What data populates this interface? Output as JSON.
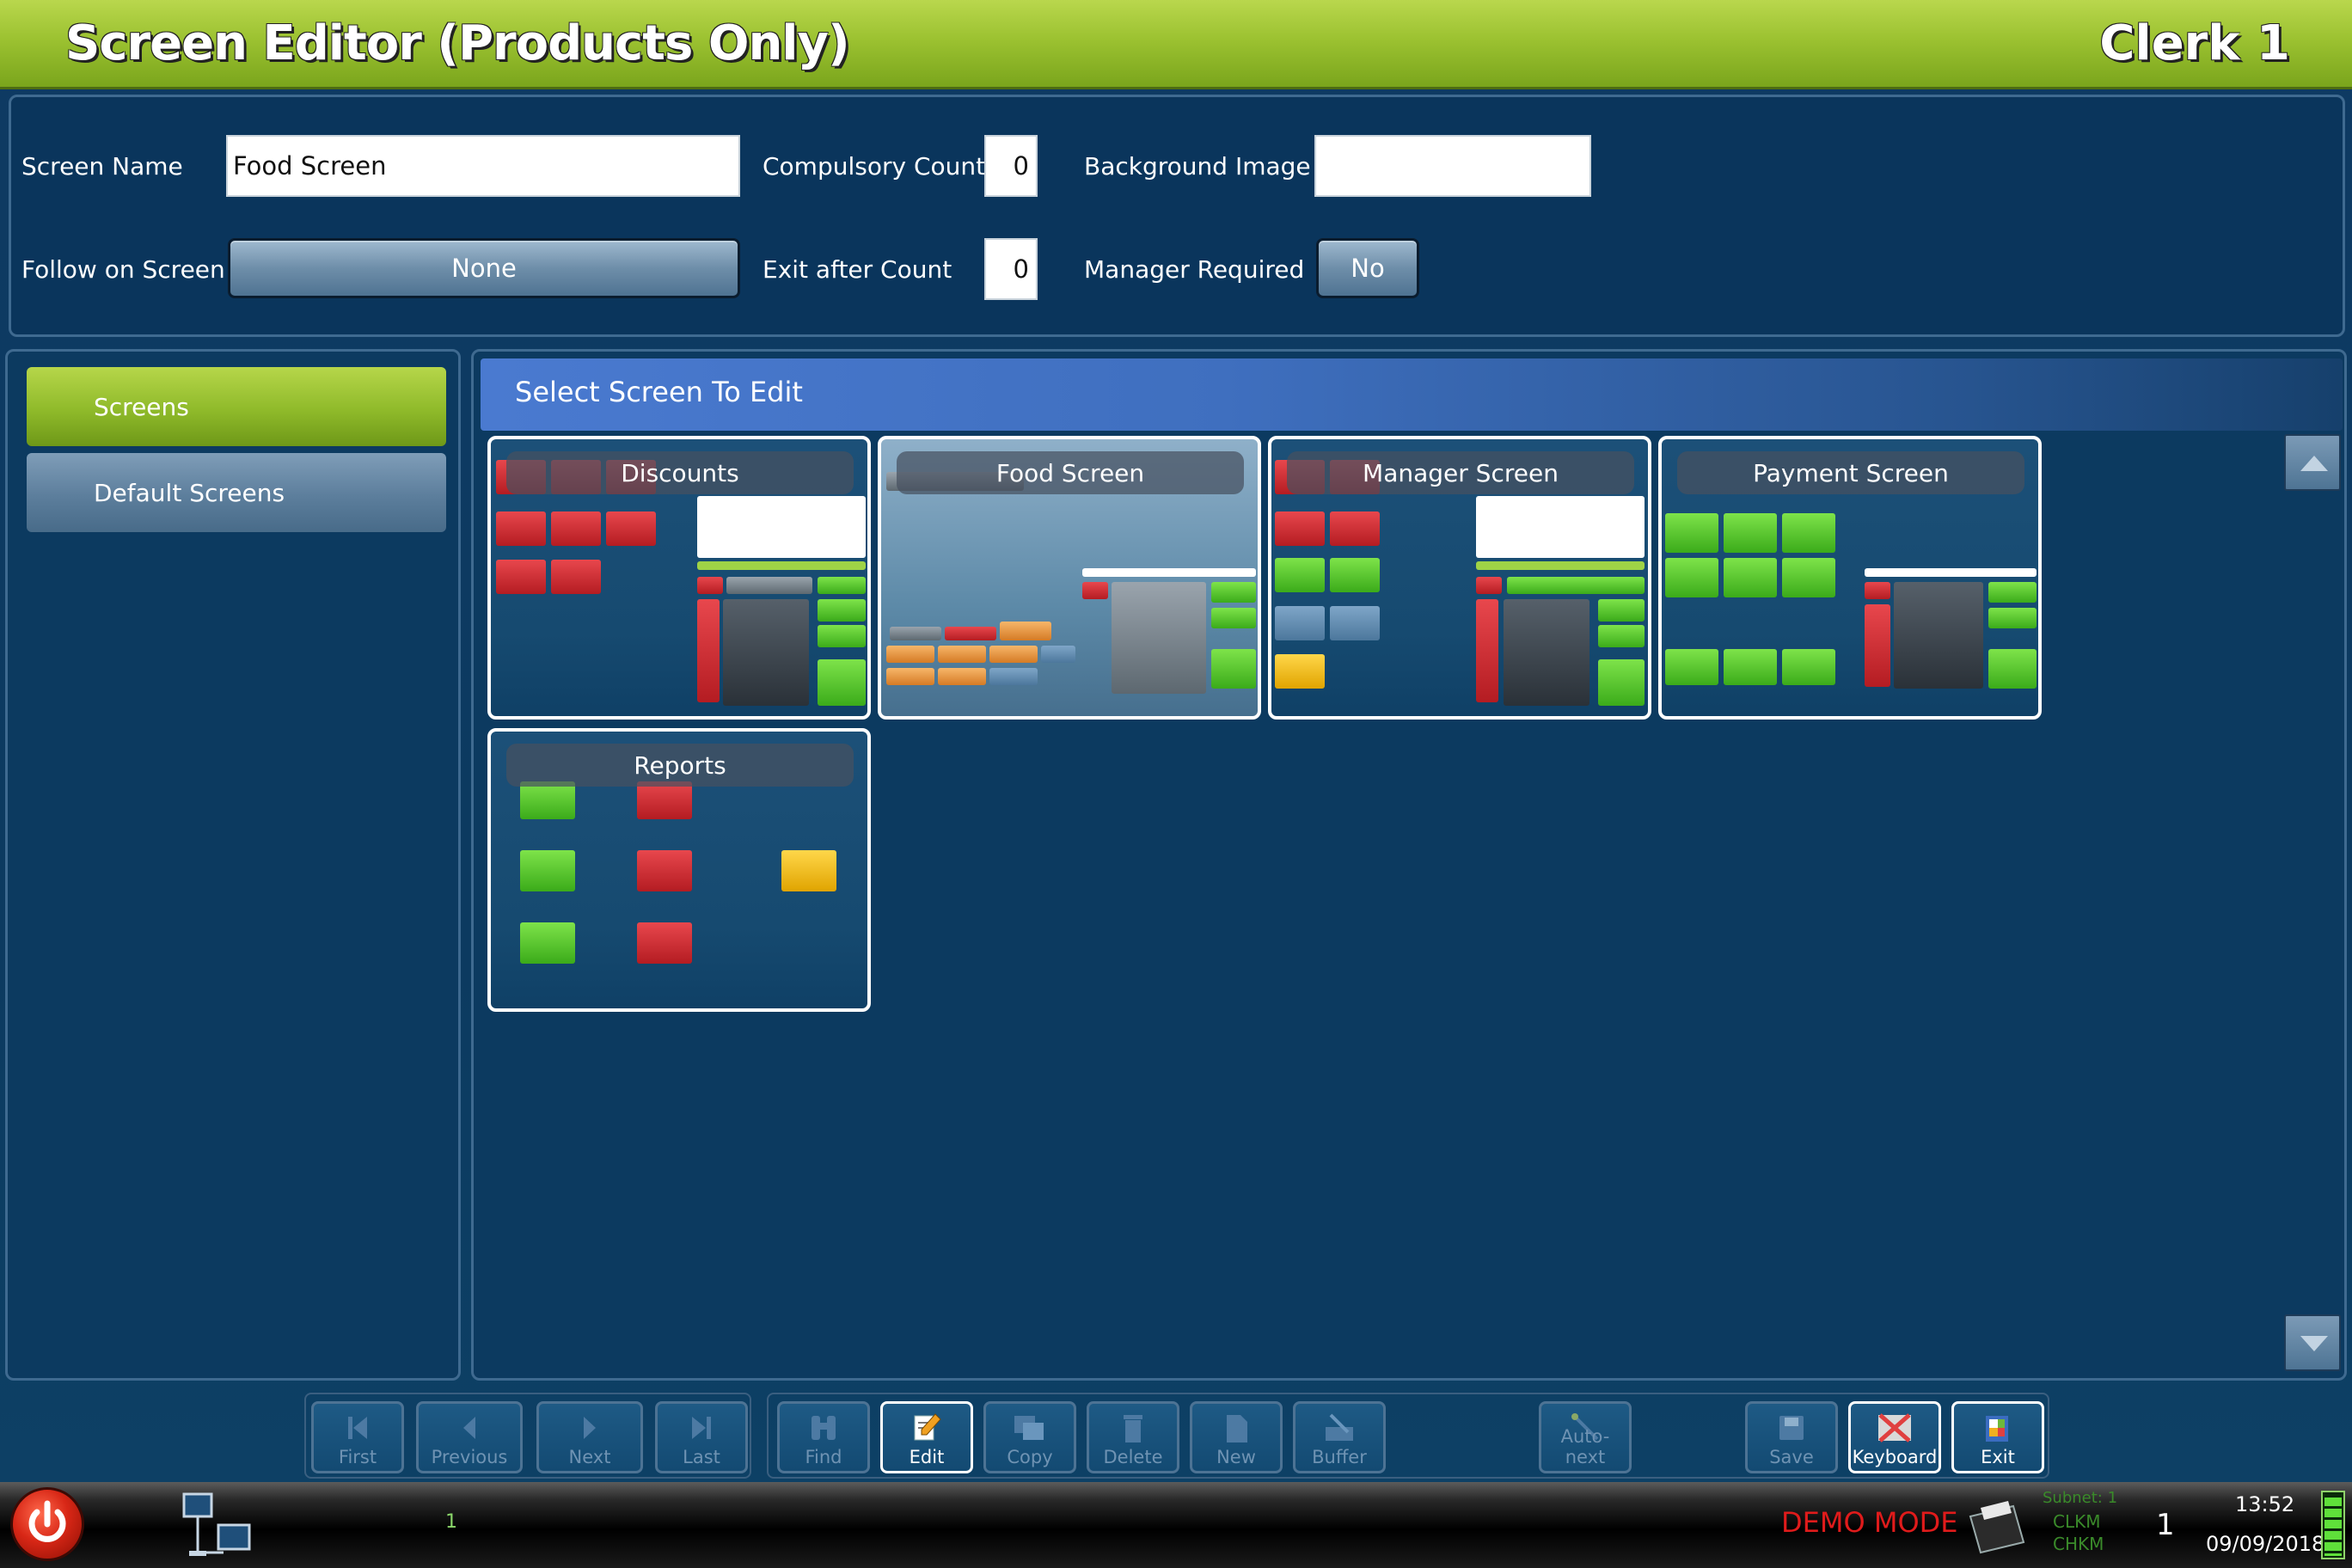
{
  "titlebar": {
    "title": "Screen Editor (Products Only)",
    "clerk": "Clerk 1"
  },
  "properties": {
    "screen_name_label": "Screen Name",
    "screen_name_value": "Food Screen",
    "compulsory_count_label": "Compulsory Count",
    "compulsory_count_value": "0",
    "background_image_label": "Background Image",
    "background_image_value": "",
    "follow_on_label": "Follow on Screen",
    "follow_on_value": "None",
    "exit_after_label": "Exit after Count",
    "exit_after_value": "0",
    "manager_required_label": "Manager Required",
    "manager_required_value": "No"
  },
  "sidebar": {
    "items": [
      {
        "label": "Screens",
        "active": true
      },
      {
        "label": "Default Screens",
        "active": false
      }
    ]
  },
  "main": {
    "header": "Select Screen To Edit",
    "tiles": [
      {
        "name": "Discounts"
      },
      {
        "name": "Food Screen"
      },
      {
        "name": "Manager Screen"
      },
      {
        "name": "Payment Screen"
      },
      {
        "name": "Reports"
      }
    ]
  },
  "toolbar": {
    "first": "First",
    "previous": "Previous",
    "next": "Next",
    "last": "Last",
    "find": "Find",
    "edit": "Edit",
    "copy": "Copy",
    "delete": "Delete",
    "new": "New",
    "buffer": "Buffer",
    "auto_next": "Auto-next",
    "save": "Save",
    "keyboard": "Keyboard",
    "exit": "Exit"
  },
  "status": {
    "counter": "1",
    "demo_mode": "DEMO MODE",
    "subnet": "Subnet: 1",
    "clkm1": "CLKM",
    "clkm2": "CHKM",
    "terminal": "1",
    "time": "13:52",
    "date": "09/09/2018"
  },
  "colors": {
    "title_green": "#9cc231",
    "panel_blue": "#0c3a60",
    "demo_red": "#e01b1b"
  }
}
